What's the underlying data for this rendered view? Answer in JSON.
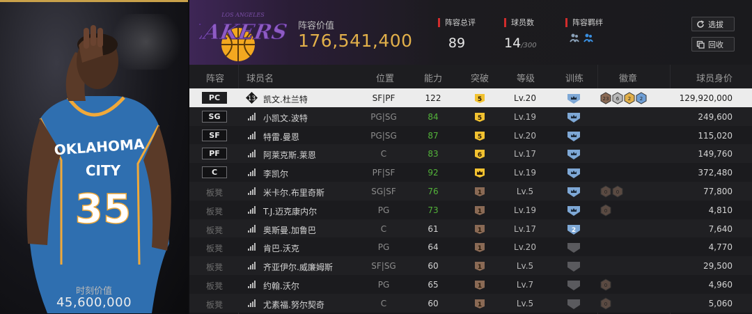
{
  "card": {
    "value_label": "时刻价值",
    "value": "45,600,000",
    "jersey": {
      "line1": "OKLAHOMA",
      "line2": "CITY",
      "number": "35"
    }
  },
  "header": {
    "team_logo_text": "LAKERS",
    "team_logo_small": "LOS ANGELES",
    "lineup_value_label": "阵容价值",
    "lineup_value": "176,541,400",
    "rating_label": "阵容总评",
    "rating": "89",
    "players_label": "球员数",
    "players_count": "14",
    "players_max": "/300",
    "bond_label": "阵容羁绊",
    "select_btn": "选拔",
    "recycle_btn": "回收"
  },
  "columns": [
    "阵容",
    "球员名",
    "位置",
    "能力",
    "突破",
    "等级",
    "训练",
    "徽章",
    "球员身价"
  ],
  "rows": [
    {
      "slot": "PC",
      "starter": true,
      "badge_num": "13",
      "name": "凯文.杜兰特",
      "pos": "SF|PF",
      "ability": "122",
      "break": "5",
      "break_color": "gold",
      "level": "Lv.20",
      "train": "",
      "badges": [
        "23",
        "6",
        "2",
        "2"
      ],
      "price": "129,920,000"
    },
    {
      "slot": "SG",
      "starter": true,
      "name": "小凯文.波特",
      "pos": "PG|SG",
      "ability": "84",
      "break": "5",
      "break_color": "gold",
      "level": "Lv.19",
      "train": "",
      "badges": [],
      "price": "249,600"
    },
    {
      "slot": "SF",
      "starter": true,
      "name": "特雷.曼恩",
      "pos": "PG|SG",
      "ability": "87",
      "break": "5",
      "break_color": "gold",
      "level": "Lv.20",
      "train": "",
      "badges": [],
      "price": "115,020"
    },
    {
      "slot": "PF",
      "starter": true,
      "name": "阿莱克斯.莱恩",
      "pos": "C",
      "ability": "83",
      "break": "6",
      "break_color": "gold",
      "level": "Lv.17",
      "train": "",
      "badges": [],
      "price": "149,760"
    },
    {
      "slot": "C",
      "starter": true,
      "name": "李凯尔",
      "pos": "PF|SF",
      "ability": "92",
      "break": "",
      "break_color": "gold",
      "level": "Lv.19",
      "train": "",
      "badges": [],
      "price": "372,480"
    },
    {
      "slot": "板凳",
      "starter": false,
      "name": "米卡尔.布里奇斯",
      "pos": "SG|SF",
      "ability": "76",
      "break": "1",
      "break_color": "bronze",
      "level": "Lv.5",
      "train": "",
      "badges": [
        "0",
        "0"
      ],
      "price": "77,800"
    },
    {
      "slot": "板凳",
      "starter": false,
      "name": "T.J.迈克康内尔",
      "pos": "PG",
      "ability": "73",
      "break": "1",
      "break_color": "bronze",
      "level": "Lv.19",
      "train": "",
      "badges": [
        "0"
      ],
      "price": "4,810"
    },
    {
      "slot": "板凳",
      "starter": false,
      "name": "奥斯曼.加鲁巴",
      "pos": "C",
      "ability": "61",
      "break": "1",
      "break_color": "bronze",
      "level": "Lv.17",
      "train": "2",
      "badges": [],
      "price": "7,640"
    },
    {
      "slot": "板凳",
      "starter": false,
      "name": "肯巴.沃克",
      "pos": "PG",
      "ability": "64",
      "break": "1",
      "break_color": "bronze",
      "level": "Lv.20",
      "train": "",
      "badges": [],
      "price": "4,770"
    },
    {
      "slot": "板凳",
      "starter": false,
      "name": "齐亚伊尔.威廉姆斯",
      "pos": "SF|SG",
      "ability": "60",
      "break": "1",
      "break_color": "bronze",
      "level": "Lv.5",
      "train": "",
      "badges": [],
      "price": "29,500"
    },
    {
      "slot": "板凳",
      "starter": false,
      "name": "约翰.沃尔",
      "pos": "PG",
      "ability": "65",
      "break": "1",
      "break_color": "bronze",
      "level": "Lv.7",
      "train": "",
      "badges": [
        "0"
      ],
      "price": "4,960"
    },
    {
      "slot": "板凳",
      "starter": false,
      "name": "尤素福.努尔契奇",
      "pos": "C",
      "ability": "60",
      "break": "1",
      "break_color": "bronze",
      "level": "Lv.5",
      "train": "",
      "badges": [
        "0"
      ],
      "price": "5,060"
    }
  ]
}
